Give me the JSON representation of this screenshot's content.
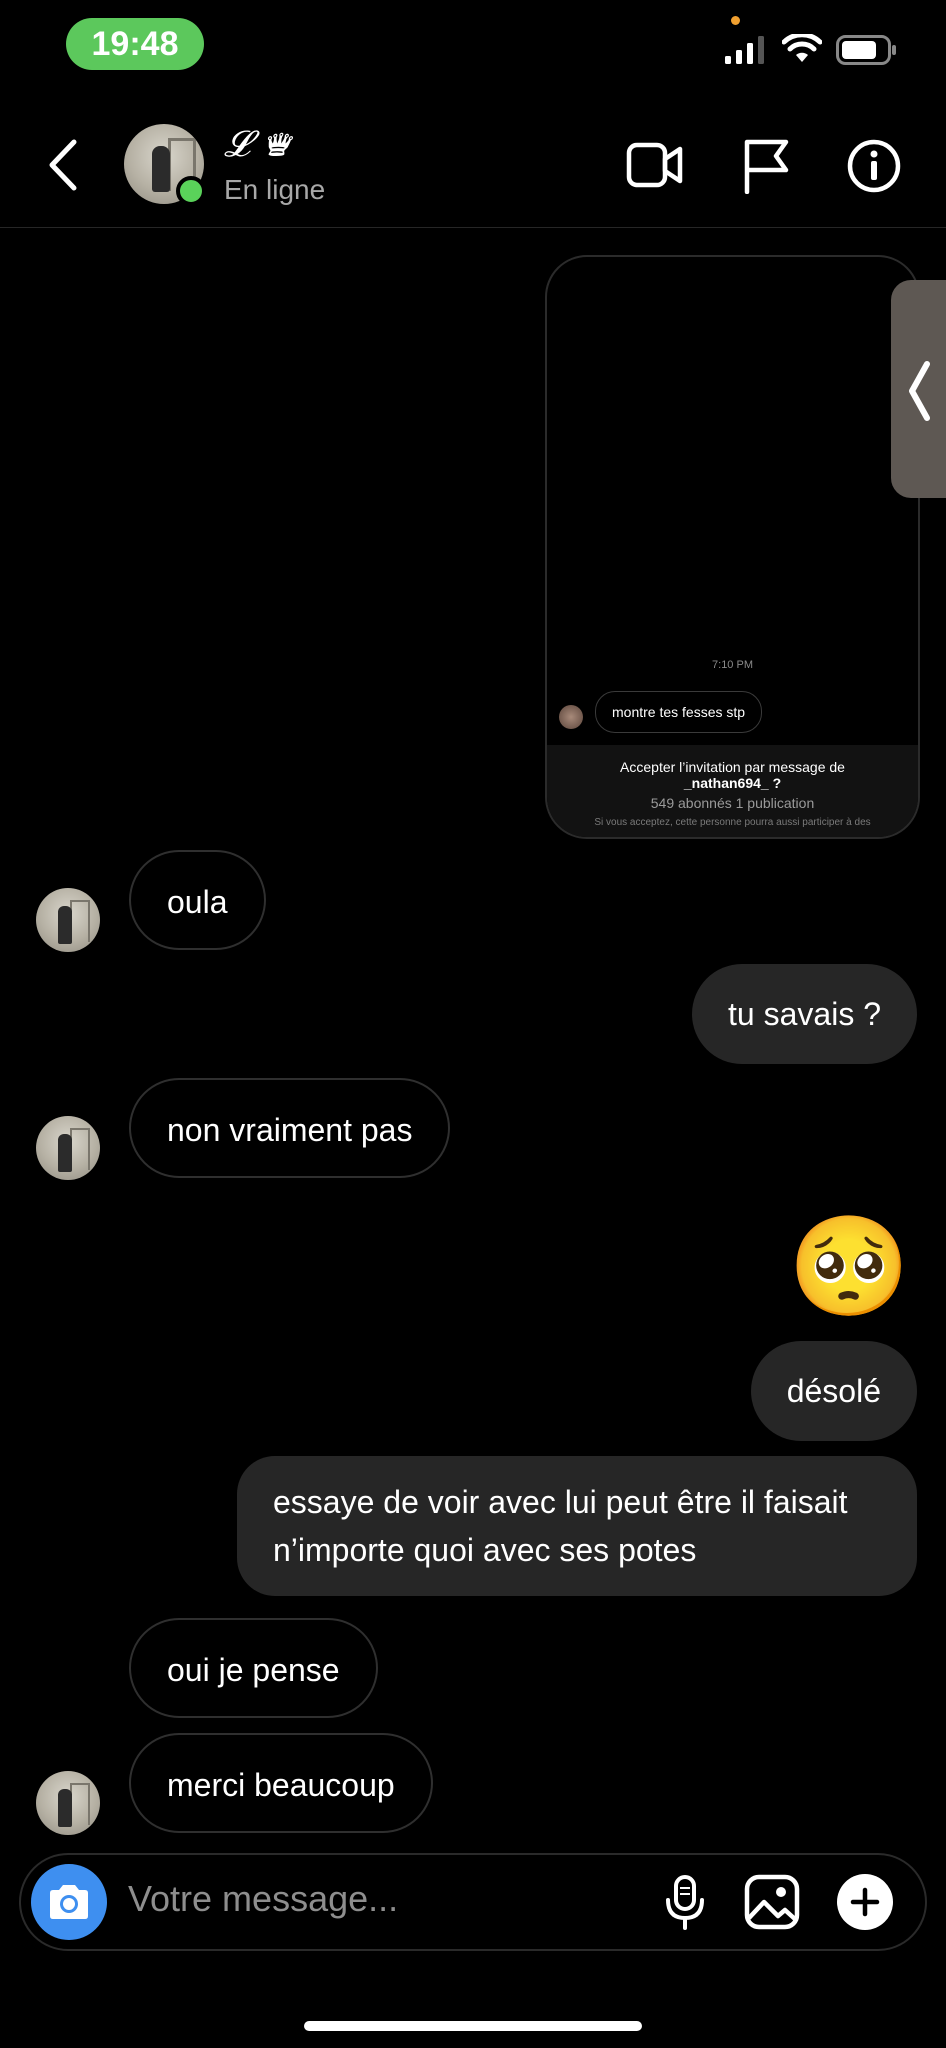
{
  "status_bar": {
    "time": "19:48"
  },
  "header": {
    "contact_name": "𝓛 ♛",
    "status": "En ligne",
    "icons": [
      "back-icon",
      "video-call-icon",
      "report-flag-icon",
      "info-icon"
    ]
  },
  "shared_screenshot": {
    "time": "7:10 PM",
    "message": "montre tes fesses stp",
    "invite_line1": "Accepter l’invitation par message de",
    "invite_user": "_nathan694_ ?",
    "invite_stats": "549 abonnés 1 publication",
    "invite_note": "Si vous acceptez, cette personne pourra aussi participer à des"
  },
  "messages": [
    {
      "from": "them",
      "text": "oula"
    },
    {
      "from": "me",
      "text": "tu savais ?"
    },
    {
      "from": "them",
      "text": "non vraiment pas"
    },
    {
      "from": "me",
      "text": "🥺",
      "type": "emoji"
    },
    {
      "from": "me",
      "text": "désolé"
    },
    {
      "from": "me",
      "text": "essaye de voir avec lui peut être il faisait n’importe quoi avec ses potes"
    },
    {
      "from": "them",
      "text": "oui je pense"
    },
    {
      "from": "them",
      "text": "merci beaucoup"
    }
  ],
  "composer": {
    "placeholder": "Votre message...",
    "icons": [
      "camera-icon",
      "microphone-icon",
      "gallery-icon",
      "plus-icon"
    ]
  },
  "colors": {
    "background": "#000000",
    "outgoing_bubble": "#262626",
    "online": "#5ad25a",
    "camera_button": "#3e8ff0",
    "time_pill": "#5cc85c"
  }
}
